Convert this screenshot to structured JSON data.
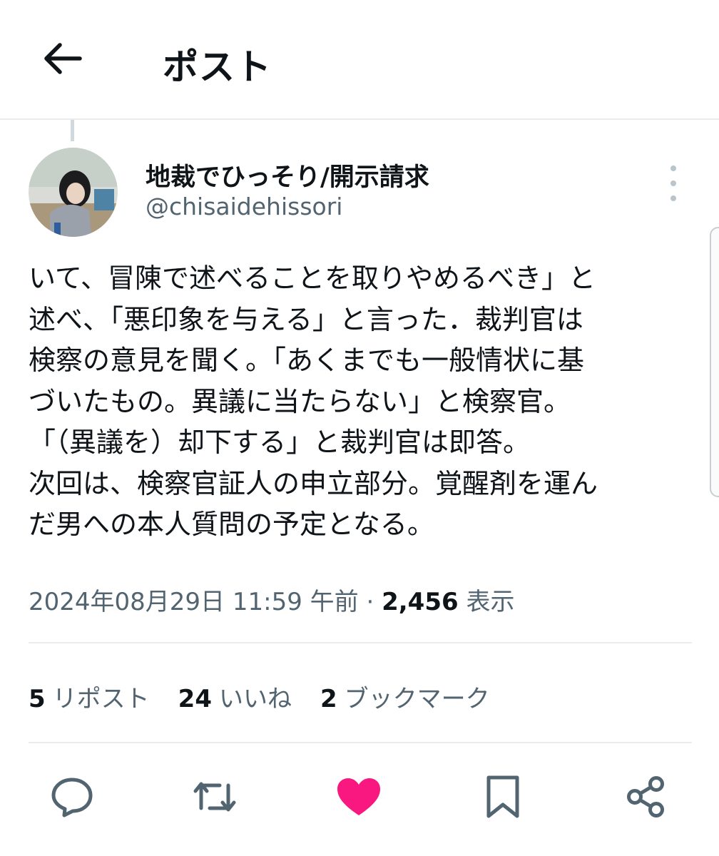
{
  "header": {
    "title": "ポスト"
  },
  "author": {
    "name": "地裁でひっそり/開示請求",
    "handle": "@chisaidehissori"
  },
  "post": {
    "lines": [
      "いて、冒陳で述べることを取りやめるべき」と",
      "述べ、「悪印象を与える」と言った．裁判官は",
      "検察の意見を聞く。「あくまでも一般情状に基",
      "づいたもの。異議に当たらない」と検察官。",
      "「（異議を）却下する」と裁判官は即答。",
      "次回は、検察官証人の申立部分。覚醒剤を運ん",
      "だ男への本人質問の予定となる。"
    ]
  },
  "meta": {
    "timestamp": "2024年08月29日 11:59 午前",
    "separator": "·",
    "views_count": "2,456",
    "views_label": "表示"
  },
  "stats": {
    "reposts_count": "5",
    "reposts_label": "リポスト",
    "likes_count": "24",
    "likes_label": "いいね",
    "bookmarks_count": "2",
    "bookmarks_label": "ブックマーク"
  },
  "actions": {
    "reply_icon": "reply-icon",
    "repost_icon": "repost-icon",
    "like_icon": "heart-icon",
    "bookmark_icon": "bookmark-icon",
    "share_icon": "share-icon"
  },
  "colors": {
    "text_primary": "#0f1419",
    "text_secondary": "#536471",
    "divider": "#e8ecee",
    "like_active": "#f91880"
  }
}
